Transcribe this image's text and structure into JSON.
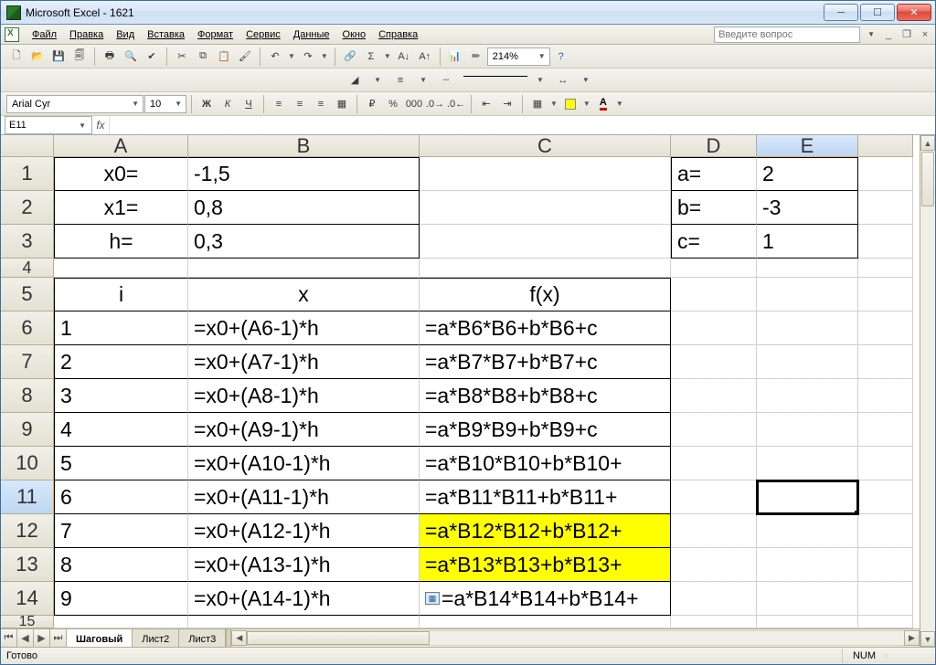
{
  "window": {
    "title": "Microsoft Excel - 1621"
  },
  "menu": [
    "Файл",
    "Правка",
    "Вид",
    "Вставка",
    "Формат",
    "Сервис",
    "Данные",
    "Окно",
    "Справка"
  ],
  "ask_placeholder": "Введите вопрос",
  "formatting": {
    "font": "Arial Cyr",
    "size": "10",
    "zoom": "214%"
  },
  "namebox": "E11",
  "columns": [
    "A",
    "B",
    "C",
    "D",
    "E"
  ],
  "active_column": "E",
  "rows_visible": 14,
  "active_row": 11,
  "selected_cell": "E11",
  "chart_data": {
    "type": "table",
    "note": "Excel worksheet showing parameters, step-table formulas, and conditional formatting on C12:C13",
    "parameters": {
      "x0": "-1,5",
      "x1": "0,8",
      "h": "0,3",
      "a": "2",
      "b": "-3",
      "c": "1"
    },
    "headers": {
      "A5": "i",
      "B5": "x",
      "C5": "f(x)"
    },
    "rows": [
      {
        "i": "1",
        "x": "=x0+(A6-1)*h",
        "fx": "=a*B6*B6+b*B6+c"
      },
      {
        "i": "2",
        "x": "=x0+(A7-1)*h",
        "fx": "=a*B7*B7+b*B7+c"
      },
      {
        "i": "3",
        "x": "=x0+(A8-1)*h",
        "fx": "=a*B8*B8+b*B8+c"
      },
      {
        "i": "4",
        "x": "=x0+(A9-1)*h",
        "fx": "=a*B9*B9+b*B9+c"
      },
      {
        "i": "5",
        "x": "=x0+(A10-1)*h",
        "fx": "=a*B10*B10+b*B10+"
      },
      {
        "i": "6",
        "x": "=x0+(A11-1)*h",
        "fx": "=a*B11*B11+b*B11+"
      },
      {
        "i": "7",
        "x": "=x0+(A12-1)*h",
        "fx": "=a*B12*B12+b*B12+",
        "hl": true
      },
      {
        "i": "8",
        "x": "=x0+(A13-1)*h",
        "fx": "=a*B13*B13+b*B13+",
        "hl": true
      },
      {
        "i": "9",
        "x": "=x0+(A14-1)*h",
        "fx": "=a*B14*B14+b*B14+",
        "tag": true
      }
    ]
  },
  "cells": {
    "A1": "x0=",
    "B1": "-1,5",
    "D1": "a=",
    "E1": "2",
    "A2": "x1=",
    "B2": "0,8",
    "D2": "b=",
    "E2": "-3",
    "A3": "h=",
    "B3": "0,3",
    "D3": "c=",
    "E3": "1",
    "A5": "i",
    "B5": "x",
    "C5": "f(x)",
    "A6": "1",
    "B6": "=x0+(A6-1)*h",
    "C6": "=a*B6*B6+b*B6+c",
    "A7": "2",
    "B7": "=x0+(A7-1)*h",
    "C7": "=a*B7*B7+b*B7+c",
    "A8": "3",
    "B8": "=x0+(A8-1)*h",
    "C8": "=a*B8*B8+b*B8+c",
    "A9": "4",
    "B9": "=x0+(A9-1)*h",
    "C9": "=a*B9*B9+b*B9+c",
    "A10": "5",
    "B10": "=x0+(A10-1)*h",
    "C10": "=a*B10*B10+b*B10+",
    "A11": "6",
    "B11": "=x0+(A11-1)*h",
    "C11": "=a*B11*B11+b*B11+",
    "A12": "7",
    "B12": "=x0+(A12-1)*h",
    "C12": "=a*B12*B12+b*B12+",
    "A13": "8",
    "B13": "=x0+(A13-1)*h",
    "C13": "=a*B13*B13+b*B13+",
    "A14": "9",
    "B14": "=x0+(A14-1)*h",
    "C14": "=a*B14*B14+b*B14+"
  },
  "tabs": [
    "Шаговый",
    "Лист2",
    "Лист3"
  ],
  "active_tab": 0,
  "status": {
    "ready": "Готово",
    "num": "NUM"
  }
}
